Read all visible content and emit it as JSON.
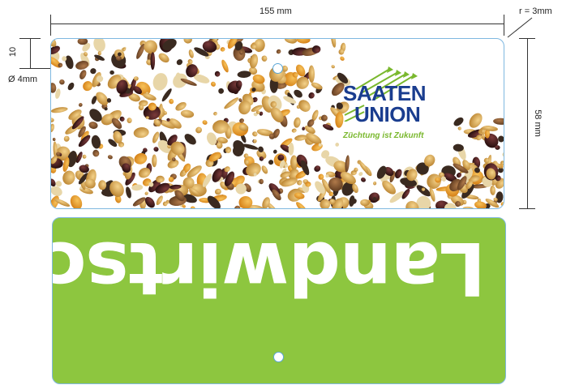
{
  "dimensions": {
    "width_label": "155 mm",
    "radius_label": "r = 3mm",
    "hole_offset_label": "10",
    "hole_diameter_label": "Ø 4mm",
    "height_label": "58 mm"
  },
  "logo": {
    "line1": "SAATEN",
    "line2": "UNION",
    "tagline": "Züchtung ist Zukunft"
  },
  "back": {
    "word": "Landwirtschaft"
  },
  "colors": {
    "back_green": "#8dc63f",
    "logo_blue": "#1a3d8f",
    "logo_green": "#7ab82e",
    "outline_blue": "#7fb8e0"
  }
}
